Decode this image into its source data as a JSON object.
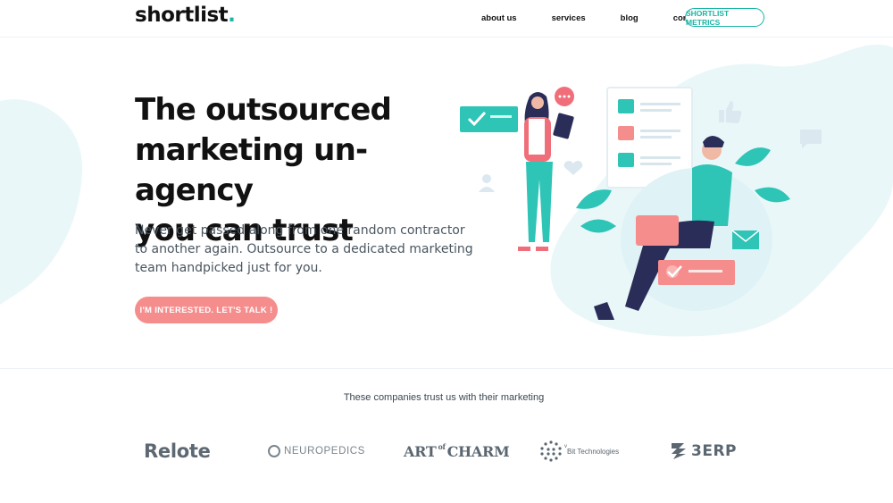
{
  "header": {
    "logo_text": "shortlist",
    "logo_dot": ".",
    "nav": [
      {
        "label": "about us"
      },
      {
        "label": "services"
      },
      {
        "label": "blog"
      },
      {
        "label": "contact us"
      }
    ],
    "metrics_label": "SHORTLIST METRICS"
  },
  "hero": {
    "headline_line1": "The outsourced",
    "headline_line2": "marketing un-agency",
    "headline_line3": "you can trust",
    "subtext": "Never get passed along from one random contractor to another again. Outsource to a dedicated marketing team handpicked just for you.",
    "cta_label": "I'M INTERESTED. LET'S TALK !"
  },
  "trust": {
    "title": "These companies trust us with their marketing",
    "logos": [
      {
        "name": "Relote"
      },
      {
        "name": "NEUROPEDICS"
      },
      {
        "name": "ART of CHARM",
        "main1": "ART",
        "small": "of",
        "main2": "CHARM"
      },
      {
        "name": "vBit Technologies",
        "small": "v",
        "main": "Bit Technologies"
      },
      {
        "name": "3ERP"
      }
    ]
  },
  "colors": {
    "accent": "#19b5a5",
    "cta": "#f68d8d",
    "blob": "#eaf7f9"
  }
}
